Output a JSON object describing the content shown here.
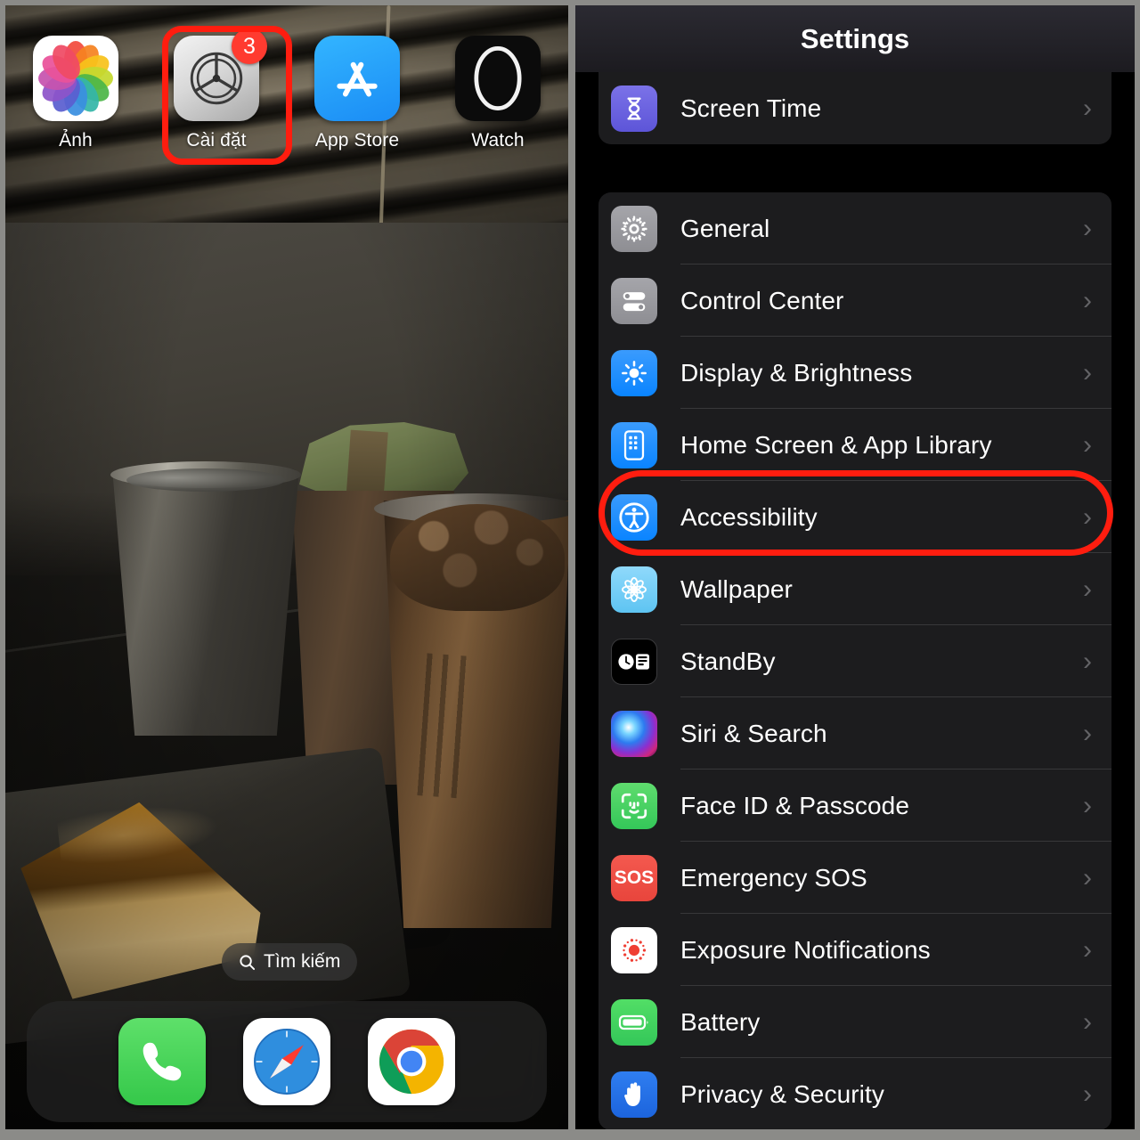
{
  "colors": {
    "highlight": "#ff1d0f",
    "badge": "#ff3b30",
    "panel_bg": "#000000",
    "card_bg": "#1c1c1e",
    "separator": "#38383a",
    "chevron": "#636366",
    "frame": "#8b8b88",
    "accent_blue": "#0a84ff"
  },
  "home_screen": {
    "apps": [
      {
        "label": "Ảnh",
        "icon": "photos-icon",
        "badge": null
      },
      {
        "label": "Cài đặt",
        "icon": "settings-gear-icon",
        "badge": "3"
      },
      {
        "label": "App Store",
        "icon": "app-store-icon",
        "badge": null
      },
      {
        "label": "Watch",
        "icon": "watch-icon",
        "badge": null
      }
    ],
    "search": {
      "label": "Tìm kiếm",
      "icon": "search-icon"
    },
    "dock": [
      {
        "label": "Phone",
        "icon": "phone-icon"
      },
      {
        "label": "Safari",
        "icon": "safari-icon"
      },
      {
        "label": "Chrome",
        "icon": "chrome-icon"
      }
    ],
    "highlighted_app": "Cài đặt"
  },
  "settings": {
    "title": "Settings",
    "chevron": "›",
    "highlighted_row": "Accessibility",
    "group_top": [
      {
        "label": "Screen Time",
        "icon": "hourglass-icon",
        "tile": "t-screentime"
      }
    ],
    "group_main": [
      {
        "label": "General",
        "icon": "gear-icon",
        "tile": "t-general"
      },
      {
        "label": "Control Center",
        "icon": "toggles-icon",
        "tile": "t-control"
      },
      {
        "label": "Display & Brightness",
        "icon": "brightness-sun-icon",
        "tile": "t-display"
      },
      {
        "label": "Home Screen & App Library",
        "icon": "home-screen-icon",
        "tile": "t-home"
      },
      {
        "label": "Accessibility",
        "icon": "accessibility-icon",
        "tile": "t-access"
      },
      {
        "label": "Wallpaper",
        "icon": "wallpaper-flower-icon",
        "tile": "t-wallpaper"
      },
      {
        "label": "StandBy",
        "icon": "standby-clock-icon",
        "tile": "t-standby"
      },
      {
        "label": "Siri & Search",
        "icon": "siri-orb-icon",
        "tile": "t-siri"
      },
      {
        "label": "Face ID & Passcode",
        "icon": "face-id-icon",
        "tile": "t-faceid"
      },
      {
        "label": "Emergency SOS",
        "icon": "sos-icon",
        "tile": "t-sos"
      },
      {
        "label": "Exposure Notifications",
        "icon": "exposure-icon",
        "tile": "t-exposure"
      },
      {
        "label": "Battery",
        "icon": "battery-icon",
        "tile": "t-battery"
      },
      {
        "label": "Privacy & Security",
        "icon": "hand-privacy-icon",
        "tile": "t-privacy"
      }
    ]
  }
}
